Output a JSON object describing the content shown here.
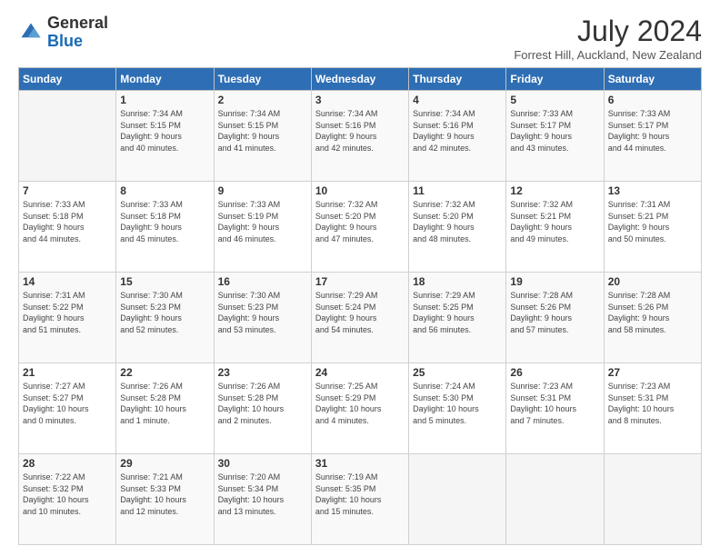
{
  "brand": {
    "name_general": "General",
    "name_blue": "Blue"
  },
  "header": {
    "month_year": "July 2024",
    "location": "Forrest Hill, Auckland, New Zealand"
  },
  "days_of_week": [
    "Sunday",
    "Monday",
    "Tuesday",
    "Wednesday",
    "Thursday",
    "Friday",
    "Saturday"
  ],
  "weeks": [
    [
      {
        "date": "",
        "info": ""
      },
      {
        "date": "1",
        "info": "Sunrise: 7:34 AM\nSunset: 5:15 PM\nDaylight: 9 hours\nand 40 minutes."
      },
      {
        "date": "2",
        "info": "Sunrise: 7:34 AM\nSunset: 5:15 PM\nDaylight: 9 hours\nand 41 minutes."
      },
      {
        "date": "3",
        "info": "Sunrise: 7:34 AM\nSunset: 5:16 PM\nDaylight: 9 hours\nand 42 minutes."
      },
      {
        "date": "4",
        "info": "Sunrise: 7:34 AM\nSunset: 5:16 PM\nDaylight: 9 hours\nand 42 minutes."
      },
      {
        "date": "5",
        "info": "Sunrise: 7:33 AM\nSunset: 5:17 PM\nDaylight: 9 hours\nand 43 minutes."
      },
      {
        "date": "6",
        "info": "Sunrise: 7:33 AM\nSunset: 5:17 PM\nDaylight: 9 hours\nand 44 minutes."
      }
    ],
    [
      {
        "date": "7",
        "info": "Sunrise: 7:33 AM\nSunset: 5:18 PM\nDaylight: 9 hours\nand 44 minutes."
      },
      {
        "date": "8",
        "info": "Sunrise: 7:33 AM\nSunset: 5:18 PM\nDaylight: 9 hours\nand 45 minutes."
      },
      {
        "date": "9",
        "info": "Sunrise: 7:33 AM\nSunset: 5:19 PM\nDaylight: 9 hours\nand 46 minutes."
      },
      {
        "date": "10",
        "info": "Sunrise: 7:32 AM\nSunset: 5:20 PM\nDaylight: 9 hours\nand 47 minutes."
      },
      {
        "date": "11",
        "info": "Sunrise: 7:32 AM\nSunset: 5:20 PM\nDaylight: 9 hours\nand 48 minutes."
      },
      {
        "date": "12",
        "info": "Sunrise: 7:32 AM\nSunset: 5:21 PM\nDaylight: 9 hours\nand 49 minutes."
      },
      {
        "date": "13",
        "info": "Sunrise: 7:31 AM\nSunset: 5:21 PM\nDaylight: 9 hours\nand 50 minutes."
      }
    ],
    [
      {
        "date": "14",
        "info": "Sunrise: 7:31 AM\nSunset: 5:22 PM\nDaylight: 9 hours\nand 51 minutes."
      },
      {
        "date": "15",
        "info": "Sunrise: 7:30 AM\nSunset: 5:23 PM\nDaylight: 9 hours\nand 52 minutes."
      },
      {
        "date": "16",
        "info": "Sunrise: 7:30 AM\nSunset: 5:23 PM\nDaylight: 9 hours\nand 53 minutes."
      },
      {
        "date": "17",
        "info": "Sunrise: 7:29 AM\nSunset: 5:24 PM\nDaylight: 9 hours\nand 54 minutes."
      },
      {
        "date": "18",
        "info": "Sunrise: 7:29 AM\nSunset: 5:25 PM\nDaylight: 9 hours\nand 56 minutes."
      },
      {
        "date": "19",
        "info": "Sunrise: 7:28 AM\nSunset: 5:26 PM\nDaylight: 9 hours\nand 57 minutes."
      },
      {
        "date": "20",
        "info": "Sunrise: 7:28 AM\nSunset: 5:26 PM\nDaylight: 9 hours\nand 58 minutes."
      }
    ],
    [
      {
        "date": "21",
        "info": "Sunrise: 7:27 AM\nSunset: 5:27 PM\nDaylight: 10 hours\nand 0 minutes."
      },
      {
        "date": "22",
        "info": "Sunrise: 7:26 AM\nSunset: 5:28 PM\nDaylight: 10 hours\nand 1 minute."
      },
      {
        "date": "23",
        "info": "Sunrise: 7:26 AM\nSunset: 5:28 PM\nDaylight: 10 hours\nand 2 minutes."
      },
      {
        "date": "24",
        "info": "Sunrise: 7:25 AM\nSunset: 5:29 PM\nDaylight: 10 hours\nand 4 minutes."
      },
      {
        "date": "25",
        "info": "Sunrise: 7:24 AM\nSunset: 5:30 PM\nDaylight: 10 hours\nand 5 minutes."
      },
      {
        "date": "26",
        "info": "Sunrise: 7:23 AM\nSunset: 5:31 PM\nDaylight: 10 hours\nand 7 minutes."
      },
      {
        "date": "27",
        "info": "Sunrise: 7:23 AM\nSunset: 5:31 PM\nDaylight: 10 hours\nand 8 minutes."
      }
    ],
    [
      {
        "date": "28",
        "info": "Sunrise: 7:22 AM\nSunset: 5:32 PM\nDaylight: 10 hours\nand 10 minutes."
      },
      {
        "date": "29",
        "info": "Sunrise: 7:21 AM\nSunset: 5:33 PM\nDaylight: 10 hours\nand 12 minutes."
      },
      {
        "date": "30",
        "info": "Sunrise: 7:20 AM\nSunset: 5:34 PM\nDaylight: 10 hours\nand 13 minutes."
      },
      {
        "date": "31",
        "info": "Sunrise: 7:19 AM\nSunset: 5:35 PM\nDaylight: 10 hours\nand 15 minutes."
      },
      {
        "date": "",
        "info": ""
      },
      {
        "date": "",
        "info": ""
      },
      {
        "date": "",
        "info": ""
      }
    ]
  ]
}
